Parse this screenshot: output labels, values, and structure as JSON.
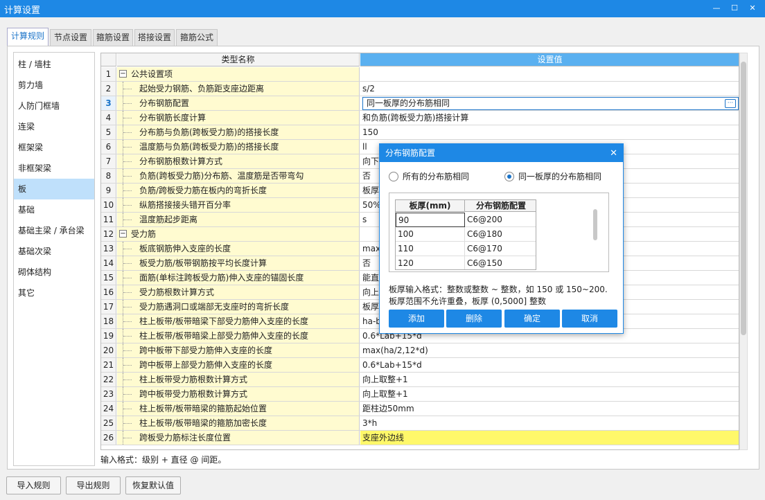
{
  "window": {
    "title": "计算设置"
  },
  "tabs": [
    "计算规则",
    "节点设置",
    "箍筋设置",
    "搭接设置",
    "箍筋公式"
  ],
  "sidebar": [
    "柱 / 墙柱",
    "剪力墙",
    "人防门框墙",
    "连梁",
    "框架梁",
    "非框架梁",
    "板",
    "基础",
    "基础主梁 / 承台梁",
    "基础次梁",
    "砌体结构",
    "其它"
  ],
  "grid": {
    "col_name": "类型名称",
    "col_value": "设置值",
    "rows": [
      {
        "n": "1",
        "name": "公共设置项",
        "value": "",
        "kind": "group"
      },
      {
        "n": "2",
        "name": "起始受力钢筋、负筋距支座边距离",
        "value": "s/2",
        "kind": "sub"
      },
      {
        "n": "3",
        "name": "分布钢筋配置",
        "value": "同一板厚的分布筋相同",
        "kind": "sub"
      },
      {
        "n": "4",
        "name": "分布钢筋长度计算",
        "value": "和负筋(跨板受力筋)搭接计算",
        "kind": "sub"
      },
      {
        "n": "5",
        "name": "分布筋与负筋(跨板受力筋)的搭接长度",
        "value": "150",
        "kind": "sub"
      },
      {
        "n": "6",
        "name": "温度筋与负筋(跨板受力筋)的搭接长度",
        "value": "ll",
        "kind": "sub"
      },
      {
        "n": "7",
        "name": "分布钢筋根数计算方式",
        "value": "向下",
        "kind": "sub"
      },
      {
        "n": "8",
        "name": "负筋(跨板受力筋)分布筋、温度筋是否带弯勾",
        "value": "否",
        "kind": "sub"
      },
      {
        "n": "9",
        "name": "负筋/跨板受力筋在板内的弯折长度",
        "value": "板厚-",
        "kind": "sub"
      },
      {
        "n": "10",
        "name": "纵筋搭接接头错开百分率",
        "value": "50%",
        "kind": "sub"
      },
      {
        "n": "11",
        "name": "温度筋起步距离",
        "value": "s",
        "kind": "sub"
      },
      {
        "n": "12",
        "name": "受力筋",
        "value": "",
        "kind": "group"
      },
      {
        "n": "13",
        "name": "板底钢筋伸入支座的长度",
        "value": "max(",
        "kind": "sub"
      },
      {
        "n": "14",
        "name": "板受力筋/板带钢筋按平均长度计算",
        "value": "否",
        "kind": "sub"
      },
      {
        "n": "15",
        "name": "面筋(单标注跨板受力筋)伸入支座的锚固长度",
        "value": "能直",
        "kind": "sub"
      },
      {
        "n": "16",
        "name": "受力筋根数计算方式",
        "value": "向上",
        "kind": "sub"
      },
      {
        "n": "17",
        "name": "受力筋遇洞口或端部无支座时的弯折长度",
        "value": "板厚-",
        "kind": "sub"
      },
      {
        "n": "18",
        "name": "柱上板带/板带暗梁下部受力筋伸入支座的长度",
        "value": "ha-b",
        "kind": "sub"
      },
      {
        "n": "19",
        "name": "柱上板带/板带暗梁上部受力筋伸入支座的长度",
        "value": "0.6*Lab+15*d",
        "kind": "sub"
      },
      {
        "n": "20",
        "name": "跨中板带下部受力筋伸入支座的长度",
        "value": "max(ha/2,12*d)",
        "kind": "sub"
      },
      {
        "n": "21",
        "name": "跨中板带上部受力筋伸入支座的长度",
        "value": "0.6*Lab+15*d",
        "kind": "sub"
      },
      {
        "n": "22",
        "name": "柱上板带受力筋根数计算方式",
        "value": "向上取整+1",
        "kind": "sub"
      },
      {
        "n": "23",
        "name": "跨中板带受力筋根数计算方式",
        "value": "向上取整+1",
        "kind": "sub"
      },
      {
        "n": "24",
        "name": "柱上板带/板带暗梁的箍筋起始位置",
        "value": "距柱边50mm",
        "kind": "sub"
      },
      {
        "n": "25",
        "name": "柱上板带/板带暗梁的箍筋加密长度",
        "value": "3*h",
        "kind": "sub"
      },
      {
        "n": "26",
        "name": "跨板受力筋标注长度位置",
        "value": "支座外边线",
        "kind": "sub"
      }
    ]
  },
  "hint": "输入格式：级别 + 直径 @ 间距。",
  "footer": [
    "导入规则",
    "导出规则",
    "恢复默认值"
  ],
  "dialog": {
    "title": "分布钢筋配置",
    "radio1": "所有的分布筋相同",
    "radio2": "同一板厚的分布筋相同",
    "col1": "板厚(mm)",
    "col2": "分布钢筋配置",
    "rows": [
      [
        "90",
        "C6@200"
      ],
      [
        "100",
        "C6@180"
      ],
      [
        "110",
        "C6@170"
      ],
      [
        "120",
        "C6@150"
      ]
    ],
    "note1": "板厚输入格式：整数或整数 ~ 整数，如 150 或 150~200.",
    "note2": "板厚范围不允许重叠，板厚 (0,5000] 整数",
    "btn_add": "添加",
    "btn_del": "删除",
    "btn_ok": "确定",
    "btn_cancel": "取消"
  }
}
